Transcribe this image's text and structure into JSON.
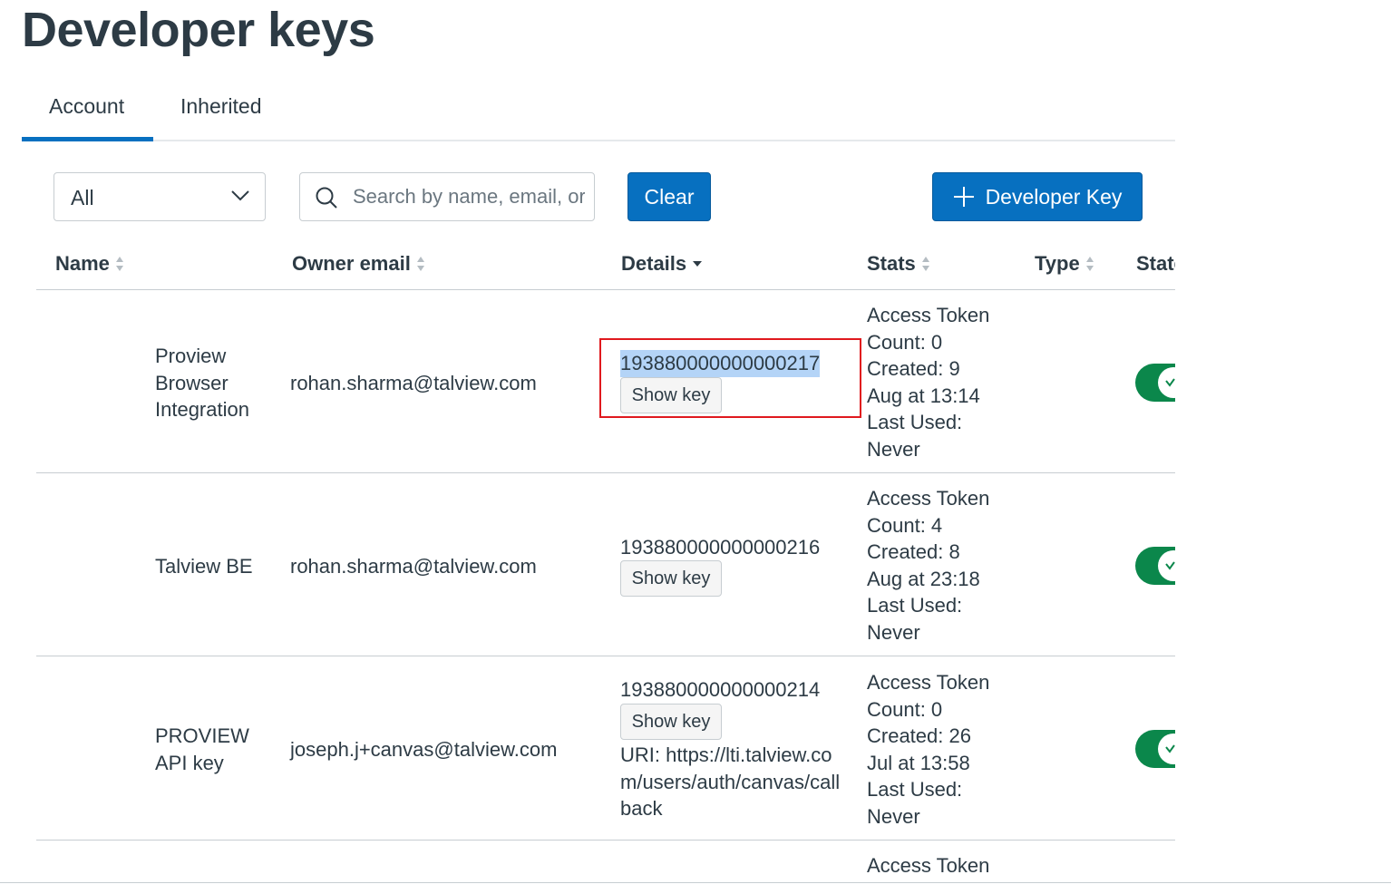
{
  "page": {
    "title": "Developer keys"
  },
  "tabs": [
    {
      "label": "Account",
      "active": true
    },
    {
      "label": "Inherited",
      "active": false
    }
  ],
  "filters": {
    "select_value": "All",
    "search_placeholder": "Search by name, email, or ID",
    "clear_label": "Clear",
    "add_label": "Developer Key"
  },
  "columns": {
    "name": "Name",
    "owner_email": "Owner email",
    "details": "Details",
    "stats": "Stats",
    "type": "Type",
    "state": "State"
  },
  "rows": [
    {
      "name": "Proview Browser Integration",
      "email": "rohan.sharma@talview.com",
      "key_id": "193880000000000217",
      "show_key": "Show key",
      "uri": "",
      "stats": [
        "Access Token",
        "Count: 0",
        "Created: 9",
        "Aug at 13:14",
        "Last Used:",
        "Never"
      ],
      "state_on": true
    },
    {
      "name": "Talview BE",
      "email": "rohan.sharma@talview.com",
      "key_id": "193880000000000216",
      "show_key": "Show key",
      "uri": "",
      "stats": [
        "Access Token",
        "Count: 4",
        "Created: 8",
        "Aug at 23:18",
        "Last Used:",
        "Never"
      ],
      "state_on": true
    },
    {
      "name": "PROVIEW API key",
      "email": "joseph.j+canvas@talview.com",
      "key_id": "193880000000000214",
      "show_key": "Show key",
      "uri": "URI: https://lti.talview.com/users/auth/canvas/callback",
      "stats": [
        "Access Token",
        "Count: 0",
        "Created: 26",
        "Jul at 13:58",
        "Last Used:",
        "Never"
      ],
      "state_on": true
    },
    {
      "stats": [
        "Access Token"
      ]
    }
  ],
  "colors": {
    "primary": "#0770c0",
    "toggle_on": "#0b874b",
    "selection": "#b4d4f7",
    "highlight_box": "#e0191e",
    "text": "#2d3b45"
  },
  "icons": {
    "search": "search-icon",
    "chevron": "chevron-down-icon",
    "plus": "plus-icon",
    "sort": "sort-icon",
    "sort_desc": "caret-down-icon",
    "toggle_check": "check-icon"
  }
}
